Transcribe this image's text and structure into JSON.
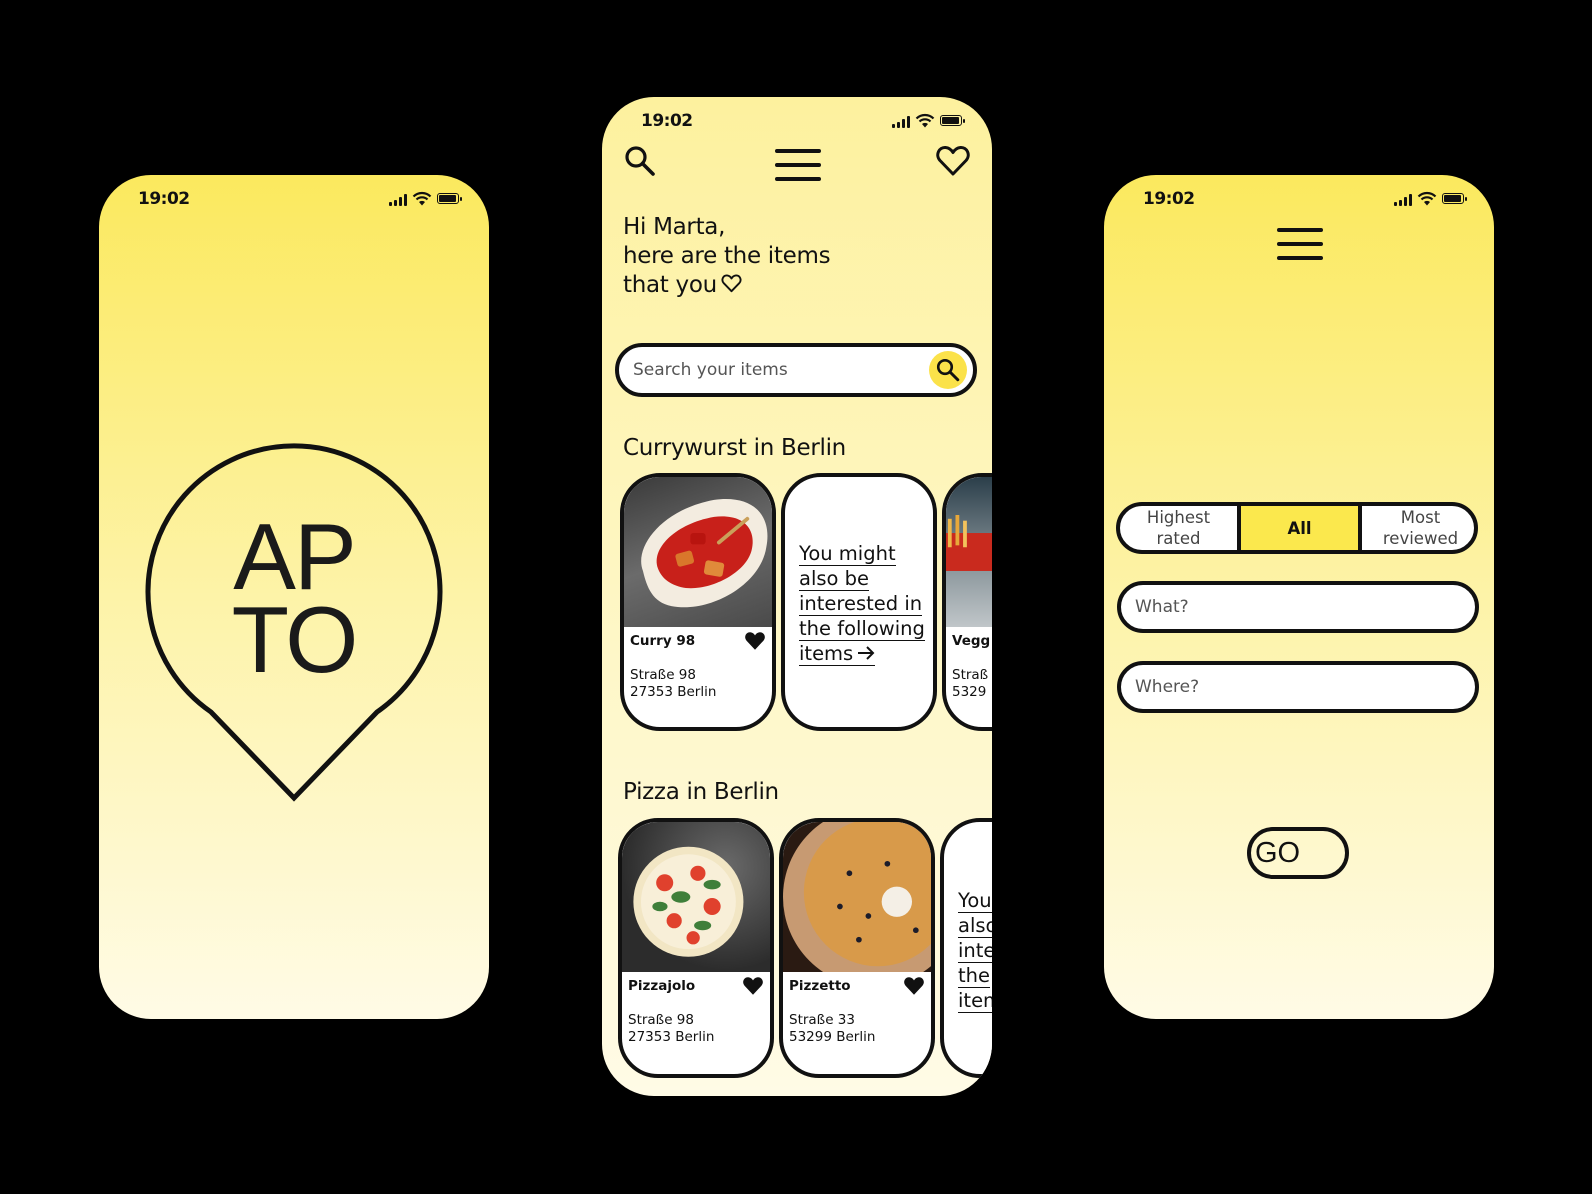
{
  "status_time": "19:02",
  "splash": {
    "logo_line1": "AP",
    "logo_line2": "TO"
  },
  "feed": {
    "greeting_line1": "Hi Marta,",
    "greeting_line2": "here are the items",
    "greeting_line3": "that you",
    "search_placeholder": "Search your items",
    "sections": [
      {
        "title": "Currywurst in Berlin",
        "cards": [
          {
            "name": "Curry 98",
            "street": "Straße 98",
            "city": "27353 Berlin"
          },
          {
            "suggest": [
              "You might",
              "also be",
              "interested in",
              "the following",
              "items"
            ]
          },
          {
            "name": "Vegg",
            "street": "Straß",
            "city": "5329"
          }
        ]
      },
      {
        "title": "Pizza in Berlin",
        "cards": [
          {
            "name": "Pizzajolo",
            "street": "Straße 98",
            "city": "27353 Berlin"
          },
          {
            "name": "Pizzetto",
            "street": "Straße 33",
            "city": "53299 Berlin"
          },
          {
            "suggest": [
              "You",
              "also",
              "inte",
              "the",
              "item"
            ]
          }
        ]
      }
    ]
  },
  "search": {
    "filter_highest": "Highest rated",
    "filter_all": "All",
    "filter_most": "Most reviewed",
    "what_placeholder": "What?",
    "where_placeholder": "Where?",
    "go_label": "GO"
  },
  "colors": {
    "accent": "#fbe84d",
    "outline": "#111111",
    "background": "#000000"
  }
}
